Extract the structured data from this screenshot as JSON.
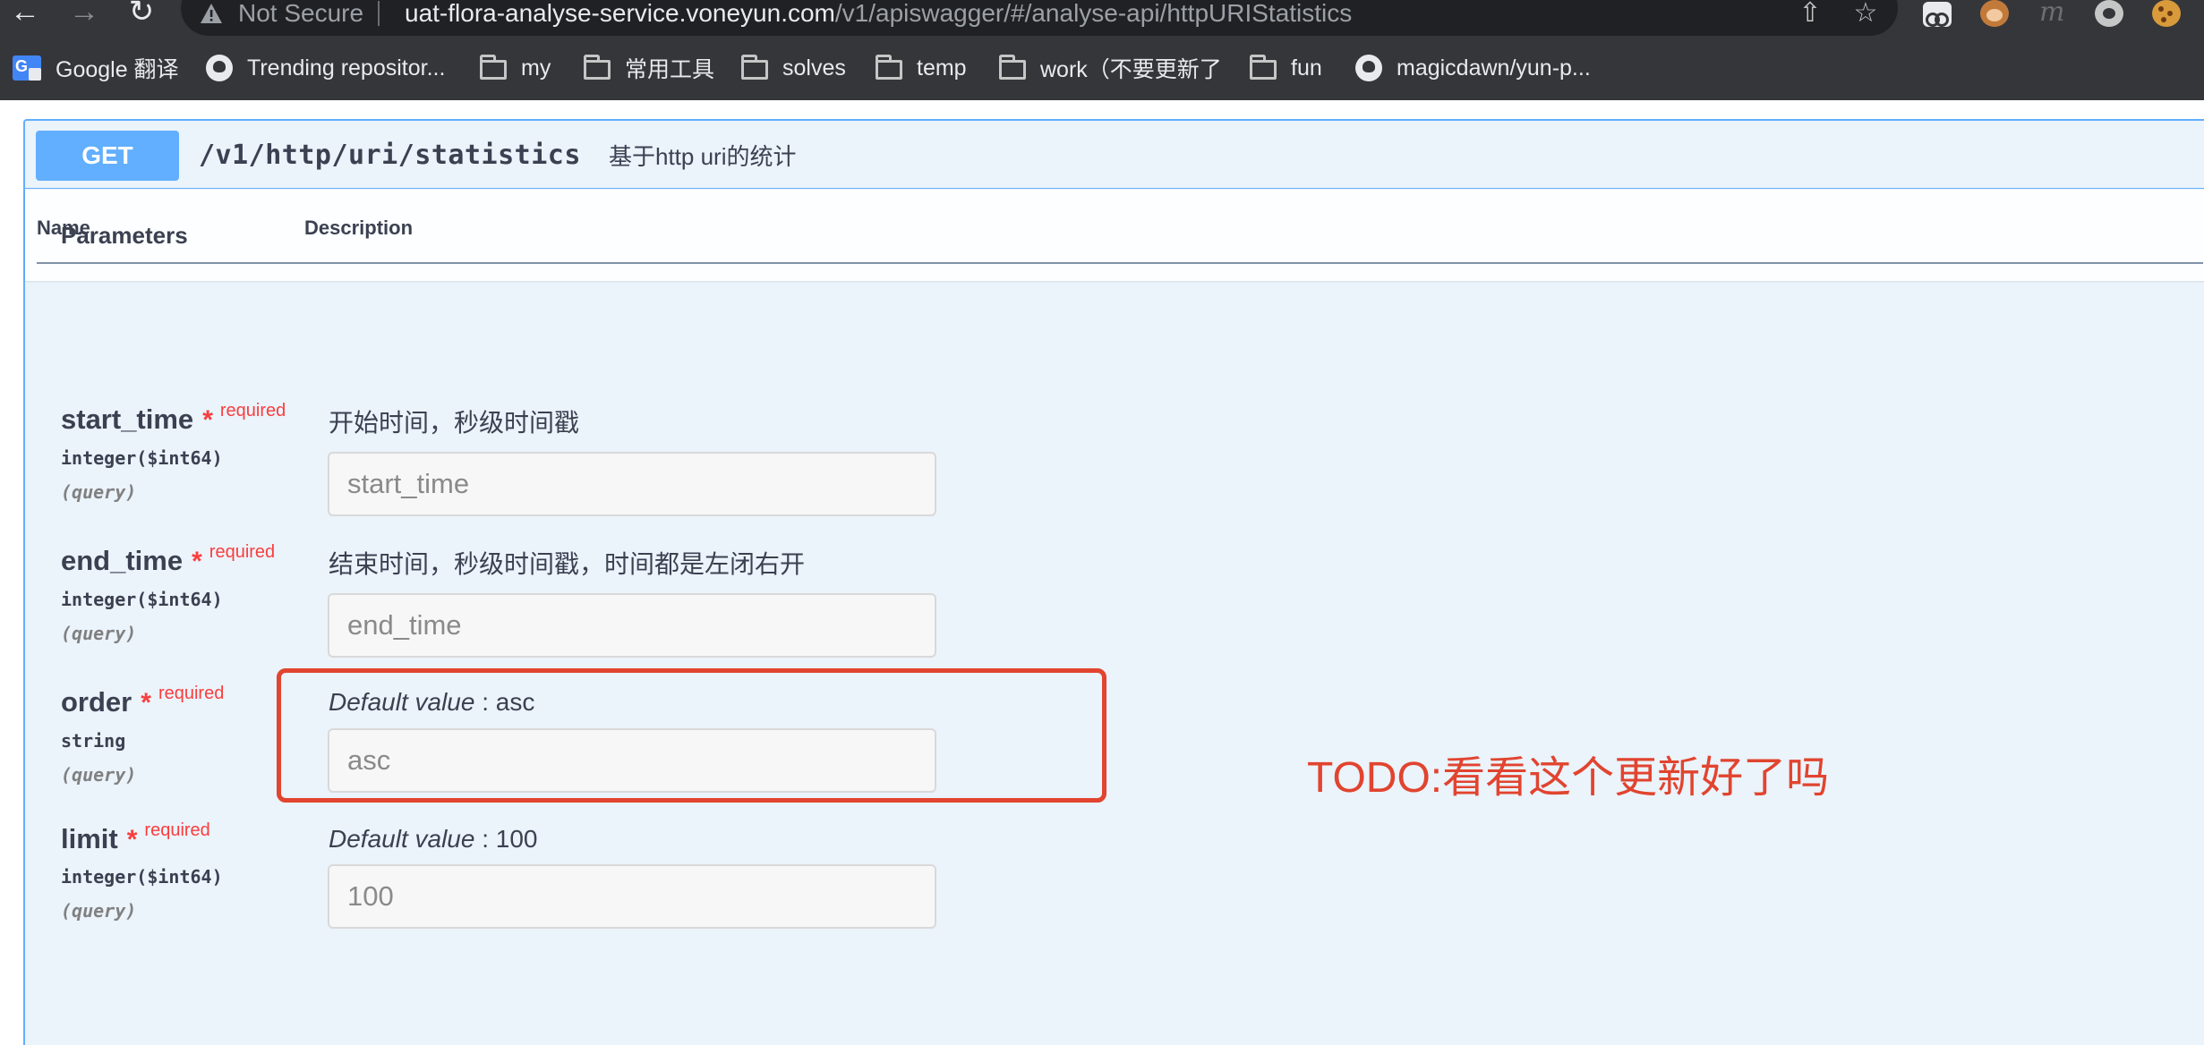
{
  "browser": {
    "nav": {
      "back": "←",
      "forward": "→",
      "reload": "↻"
    },
    "security_label": "Not Secure",
    "url": {
      "host": "uat-flora-analyse-service.voneyun.com",
      "path": "/v1/apiswagger/#/analyse-api/httpURIStatistics"
    },
    "omnibox_actions": {
      "share": "⇧",
      "bookmark_star": "☆"
    },
    "extension_icons": [
      "tab-search-icon",
      "monkey-icon",
      "m-icon",
      "circle-icon",
      "cookie-icon"
    ],
    "extension_m_text": "m",
    "bookmarks": [
      {
        "label": "Google 翻译",
        "icon": "google-translate-icon"
      },
      {
        "label": "Trending repositor...",
        "icon": "github-icon"
      },
      {
        "label": "my",
        "icon": "folder-icon"
      },
      {
        "label": "常用工具",
        "icon": "folder-icon"
      },
      {
        "label": "solves",
        "icon": "folder-icon"
      },
      {
        "label": "temp",
        "icon": "folder-icon"
      },
      {
        "label": "work（不要更新了",
        "icon": "folder-icon"
      },
      {
        "label": "fun",
        "icon": "folder-icon"
      },
      {
        "label": "magicdawn/yun-p...",
        "icon": "github-icon"
      }
    ]
  },
  "operation": {
    "method": "GET",
    "path": "/v1/http/uri/statistics",
    "summary": "基于http uri的统计",
    "section_title": "Parameters",
    "columns": {
      "name": "Name",
      "description": "Description"
    },
    "required_label": "required",
    "required_star": "*",
    "parameters": [
      {
        "name": "start_time",
        "type": "integer($int64)",
        "in": "(query)",
        "description": "开始时间，秒级时间戳",
        "placeholder": "start_time"
      },
      {
        "name": "end_time",
        "type": "integer($int64)",
        "in": "(query)",
        "description": "结束时间，秒级时间戳，时间都是左闭右开",
        "placeholder": "end_time"
      },
      {
        "name": "order",
        "type": "string",
        "in": "(query)",
        "default_key": "Default value",
        "default_sep": " : ",
        "default_value": "asc",
        "placeholder": "asc"
      },
      {
        "name": "limit",
        "type": "integer($int64)",
        "in": "(query)",
        "default_key": "Default value",
        "default_sep": " : ",
        "default_value": "100",
        "placeholder": "100"
      }
    ]
  },
  "annotation": {
    "text": "TODO:看看这个更新好了吗",
    "color": "#e1442f"
  },
  "colors": {
    "get_method": "#61affe",
    "required": "#f93e3e",
    "chrome_bg": "#35363a"
  }
}
